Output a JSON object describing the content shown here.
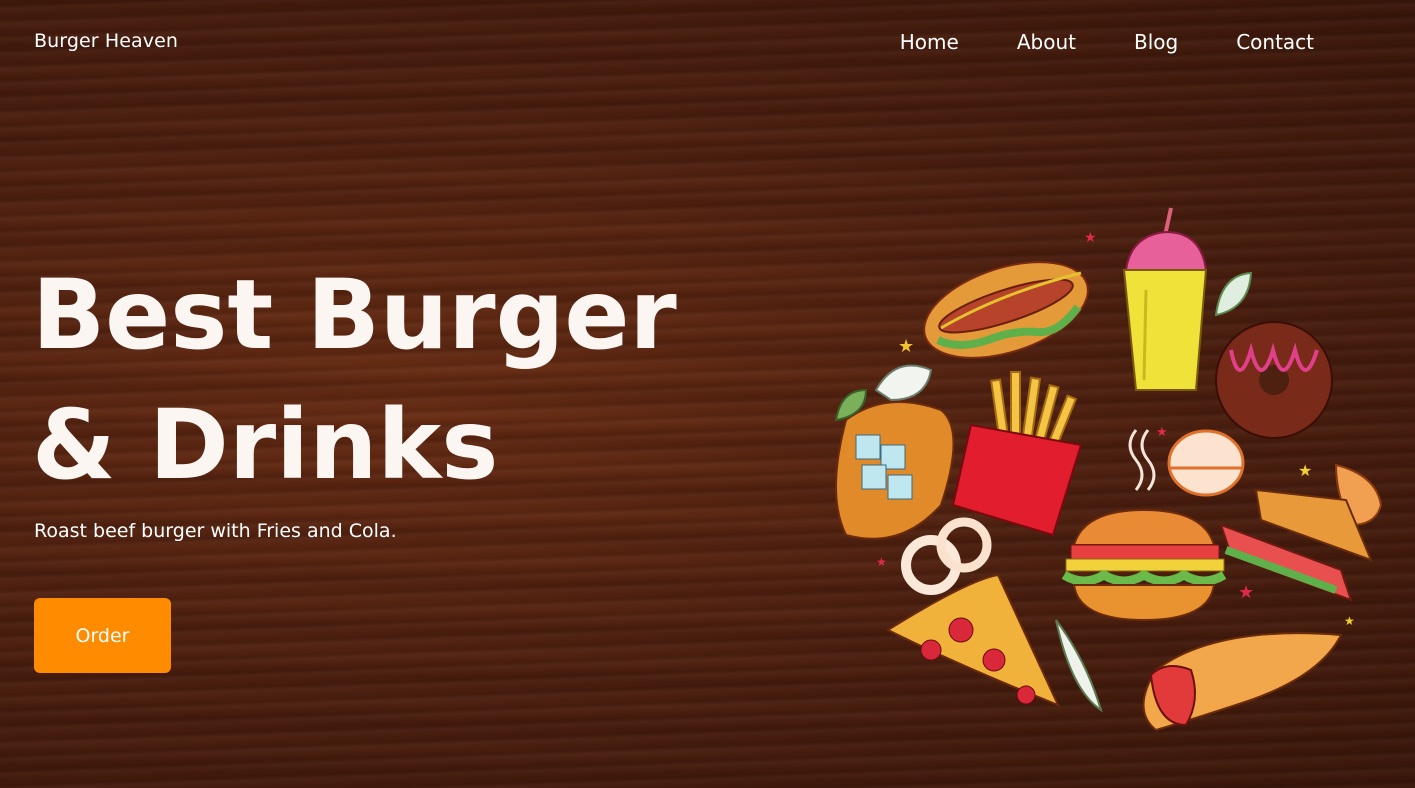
{
  "header": {
    "brand": "Burger Heaven",
    "nav": [
      "Home",
      "About",
      "Blog",
      "Contact"
    ]
  },
  "hero": {
    "title_line1": "Best Burger",
    "title_line2": "& Drinks",
    "subtitle": "Roast beef burger with Fries and Cola.",
    "cta_label": "Order"
  },
  "colors": {
    "accent": "#ff8c00",
    "background": "#4d2010",
    "text": "#ffffff"
  },
  "illustration": {
    "icons": [
      "hotdog-icon",
      "milkshake-icon",
      "donut-icon",
      "fries-icon",
      "toast-icon",
      "macaron-icon",
      "croissant-icon",
      "burger-icon",
      "sandwich-icon",
      "onion-rings-icon",
      "pizza-slice-icon",
      "wrap-icon",
      "leaf-icon",
      "star-icon"
    ]
  }
}
